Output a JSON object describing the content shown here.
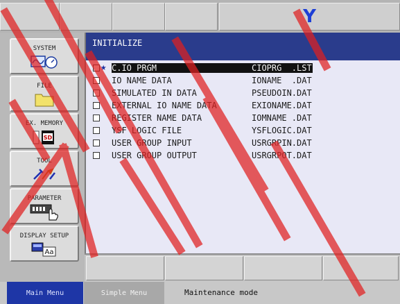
{
  "header": {
    "robot_indicator": "Y"
  },
  "left_menu": {
    "items": [
      {
        "label": "SYSTEM"
      },
      {
        "label": "FILE"
      },
      {
        "label": "EX. MEMORY"
      },
      {
        "label": "TOOL"
      },
      {
        "label": "PARAMETER"
      },
      {
        "label": "DISPLAY SETUP"
      }
    ]
  },
  "main": {
    "title": "INITIALIZE",
    "files": [
      {
        "name": "C.IO PRGM",
        "file": "CIOPRG  .LST",
        "selected": true,
        "starred": true
      },
      {
        "name": "IO NAME DATA",
        "file": "IONAME  .DAT"
      },
      {
        "name": "SIMULATED IN DATA",
        "file": "PSEUDOIN.DAT"
      },
      {
        "name": "EXTERNAL IO NAME DATA",
        "file": "EXIONAME.DAT"
      },
      {
        "name": "REGISTER NAME DATA",
        "file": "IOMNAME .DAT"
      },
      {
        "name": "YSF LOGIC FILE",
        "file": "YSFLOGIC.DAT"
      },
      {
        "name": "USER GROUP INPUT",
        "file": "USRGRPIN.DAT"
      },
      {
        "name": "USER GROUP OUTPUT",
        "file": "USRGRPOT.DAT"
      }
    ]
  },
  "status_bar": {
    "main_menu": "Main Menu",
    "simple_menu": "Simple Menu",
    "mode": "Maintenance mode"
  },
  "colors": {
    "title_bar": "#2a3c8c",
    "robot_indicator": "#1d3fd6",
    "main_menu_button": "#1e36a6",
    "watermark": "#e02020"
  },
  "icons": {
    "system": "oscilloscope-gauge-icon",
    "file": "folder-icon",
    "ex_memory": "sd-card-icon",
    "tool": "tools-icon",
    "parameter": "board-hand-pointer-icon",
    "display_setup": "display-font-icon",
    "selected_marker": "star-icon"
  }
}
